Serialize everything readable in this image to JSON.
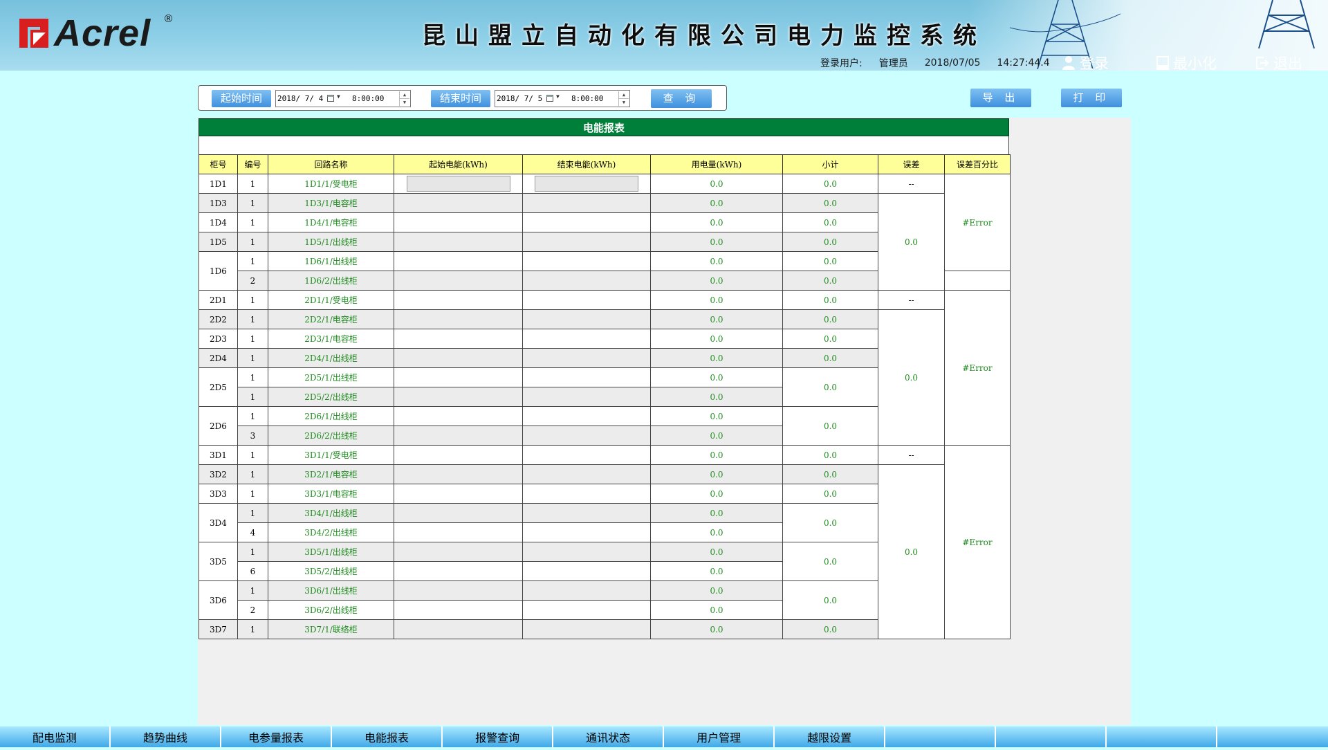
{
  "header": {
    "logo_text": "Acrel",
    "logo_mark": "®",
    "system_title": "昆山盟立自动化有限公司电力监控系统",
    "login_user_label": "登录用户:",
    "user_name": "管理员",
    "date": "2018/07/05",
    "time": "14:27:44.4",
    "login_label": "登录",
    "minimize_label": "最小化",
    "exit_label": "退出",
    "icons": {
      "login": "user-icon",
      "minimize": "minimize-icon",
      "exit": "exit-icon"
    }
  },
  "toolbar": {
    "start_label": "起始时间",
    "start_date": "2018/ 7/ 4",
    "start_time": "8:00:00",
    "end_label": "结束时间",
    "end_date": "2018/ 7/ 5",
    "end_time": "8:00:00",
    "query_label": "查 询",
    "export_label": "导 出",
    "print_label": "打 印",
    "icons": {
      "calendar": "calendar-icon",
      "spin": "spin-icon"
    }
  },
  "report": {
    "title": "电能报表",
    "columns": [
      "柜号",
      "编号",
      "回路名称",
      "起始电能(kWh)",
      "结束电能(kWh)",
      "用电量(kWh)",
      "小计",
      "误差",
      "误差百分比"
    ],
    "rows": [
      {
        "cab": "1D1",
        "num": "1",
        "name": "1D1/1/受电柜",
        "usage": "0.0",
        "subtotal": "0.0",
        "error": "--"
      },
      {
        "cab": "1D3",
        "num": "1",
        "name": "1D3/1/电容柜",
        "usage": "0.0",
        "subtotal": "0.0"
      },
      {
        "cab": "1D4",
        "num": "1",
        "name": "1D4/1/电容柜",
        "usage": "0.0",
        "subtotal": "0.0"
      },
      {
        "cab": "1D5",
        "num": "1",
        "name": "1D5/1/出线柜",
        "usage": "0.0",
        "subtotal": "0.0"
      },
      {
        "cab": "1D6",
        "num": "1",
        "name": "1D6/1/出线柜",
        "usage": "0.0",
        "subtotal": "0.0"
      },
      {
        "num": "2",
        "name": "1D6/2/出线柜",
        "usage": "0.0",
        "subtotal": "0.0"
      },
      {
        "cab": "2D1",
        "num": "1",
        "name": "2D1/1/受电柜",
        "usage": "0.0",
        "subtotal": "0.0",
        "error": "--"
      },
      {
        "cab": "2D2",
        "num": "1",
        "name": "2D2/1/电容柜",
        "usage": "0.0",
        "subtotal": "0.0"
      },
      {
        "cab": "2D3",
        "num": "1",
        "name": "2D3/1/电容柜",
        "usage": "0.0",
        "subtotal": "0.0"
      },
      {
        "cab": "2D4",
        "num": "1",
        "name": "2D4/1/出线柜",
        "usage": "0.0",
        "subtotal": "0.0"
      },
      {
        "cab": "2D5",
        "num": "1",
        "name": "2D5/1/出线柜",
        "usage": "0.0",
        "subtotal": "0.0"
      },
      {
        "num": "1",
        "name": "2D5/2/出线柜",
        "usage": "0.0"
      },
      {
        "cab": "2D6",
        "num": "1",
        "name": "2D6/1/出线柜",
        "usage": "0.0",
        "subtotal": "0.0"
      },
      {
        "num": "3",
        "name": "2D6/2/出线柜",
        "usage": "0.0"
      },
      {
        "cab": "3D1",
        "num": "1",
        "name": "3D1/1/受电柜",
        "usage": "0.0",
        "subtotal": "0.0",
        "error": "--"
      },
      {
        "cab": "3D2",
        "num": "1",
        "name": "3D2/1/电容柜",
        "usage": "0.0",
        "subtotal": "0.0"
      },
      {
        "cab": "3D3",
        "num": "1",
        "name": "3D3/1/电容柜",
        "usage": "0.0",
        "subtotal": "0.0"
      },
      {
        "cab": "3D4",
        "num": "1",
        "name": "3D4/1/出线柜",
        "usage": "0.0",
        "subtotal": "0.0"
      },
      {
        "num": "4",
        "name": "3D4/2/出线柜",
        "usage": "0.0"
      },
      {
        "cab": "3D5",
        "num": "1",
        "name": "3D5/1/出线柜",
        "usage": "0.0",
        "subtotal": "0.0"
      },
      {
        "num": "6",
        "name": "3D5/2/出线柜",
        "usage": "0.0"
      },
      {
        "cab": "3D6",
        "num": "1",
        "name": "3D6/1/出线柜",
        "usage": "0.0",
        "subtotal": "0.0"
      },
      {
        "num": "2",
        "name": "3D6/2/出线柜",
        "usage": "0.0"
      },
      {
        "cab": "3D7",
        "num": "1",
        "name": "3D7/1/联络柜",
        "usage": "0.0",
        "subtotal": "0.0"
      }
    ],
    "group_errors": [
      "0.0",
      "0.0",
      "0.0"
    ],
    "group_error_pcts": [
      "#Error",
      "#Error",
      "#Error"
    ]
  },
  "nav": {
    "items": [
      "配电监测",
      "趋势曲线",
      "电参量报表",
      "电能报表",
      "报警查询",
      "通讯状态",
      "用户管理",
      "越限设置",
      "",
      "",
      "",
      ""
    ]
  },
  "colors": {
    "page_bg": "#ccffff",
    "title_bar": "#007f3a",
    "header_row": "#ffff99",
    "value_text": "#1e8a1e",
    "button": "#3f90de"
  }
}
